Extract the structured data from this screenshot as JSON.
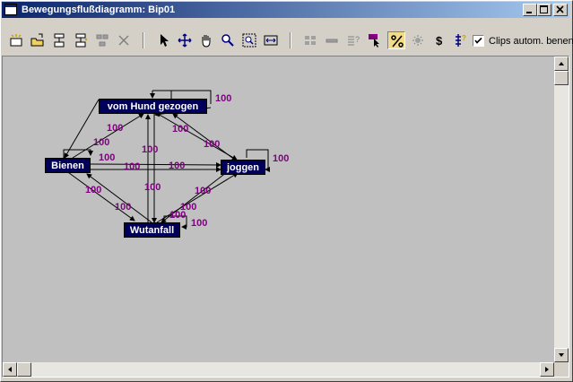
{
  "window": {
    "title": "Bewegungsflußdiagramm: Bip01",
    "controls": [
      "minimize-icon",
      "maximize-icon",
      "close-icon"
    ]
  },
  "toolbar": {
    "tools": [
      {
        "name": "new-node-icon"
      },
      {
        "name": "open-node-icon"
      },
      {
        "name": "add-node-icon"
      },
      {
        "name": "add-node-star-icon"
      },
      {
        "name": "group-nodes-icon"
      },
      {
        "name": "delete-icon"
      },
      {
        "name": "select-arrow-icon"
      },
      {
        "name": "move-icon"
      },
      {
        "name": "pan-hand-icon"
      },
      {
        "name": "zoom-icon"
      },
      {
        "name": "zoom-region-icon"
      },
      {
        "name": "fit-width-icon"
      },
      {
        "name": "layout-icon"
      },
      {
        "name": "bar-icon"
      },
      {
        "name": "list-properties-icon"
      },
      {
        "name": "flag-select-icon"
      },
      {
        "name": "percent-icon",
        "pressed": true
      },
      {
        "name": "random-icon"
      },
      {
        "name": "dollar-icon"
      },
      {
        "name": "script-icon"
      }
    ],
    "clips_checkbox": {
      "label": "Clips autom. benen",
      "checked": true
    }
  },
  "diagram": {
    "nodes": [
      {
        "id": "vom-hund",
        "label": "vom Hund gezogen"
      },
      {
        "id": "bienen",
        "label": "Bienen"
      },
      {
        "id": "joggen",
        "label": "joggen"
      },
      {
        "id": "wutanfall",
        "label": "Wutanfall"
      }
    ],
    "transition_weight": "100",
    "colors": {
      "node_bg": "#00005a",
      "label": "#800080",
      "canvas": "#c0c0c0"
    }
  }
}
